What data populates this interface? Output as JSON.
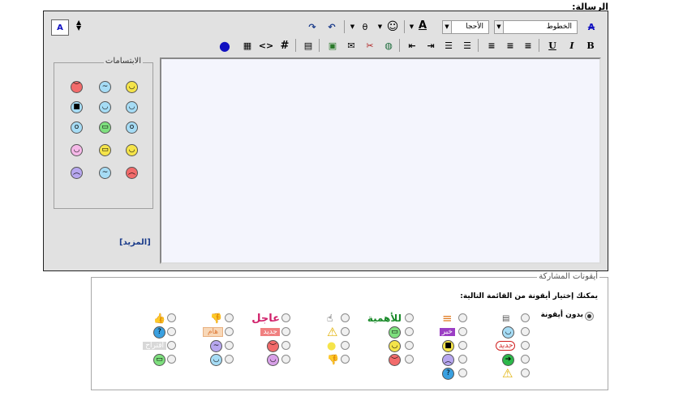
{
  "message_label": "الرسالة:",
  "toolbar": {
    "font_select": "الخطوط",
    "size_select": "الأحجا",
    "bold": "B",
    "italic": "I",
    "underline": "U",
    "font_color_letter": "A",
    "hash": "#",
    "code": "<>",
    "font_color": "#1010c0",
    "active_color": "#000000"
  },
  "smilies": {
    "legend": "الابتسامات",
    "more": "[المزيد]",
    "items": [
      {
        "name": "smile-icon",
        "color": "#f5e44a",
        "glyph": "◡"
      },
      {
        "name": "confused-icon",
        "color": "#a6dcf5",
        "glyph": "~"
      },
      {
        "name": "angry-icon",
        "color": "#f26b6b",
        "glyph": "︶"
      },
      {
        "name": "cool-icon",
        "color": "#a6dcf5",
        "glyph": "◡"
      },
      {
        "name": "grin-blue-icon",
        "color": "#a6dcf5",
        "glyph": "◡"
      },
      {
        "name": "sunglasses-icon",
        "color": "#a6dcf5",
        "glyph": "■"
      },
      {
        "name": "shock-icon",
        "color": "#a6dcf5",
        "glyph": "o"
      },
      {
        "name": "teeth-icon",
        "color": "#7ee07e",
        "glyph": "▭"
      },
      {
        "name": "scared-icon",
        "color": "#a6dcf5",
        "glyph": "o"
      },
      {
        "name": "wink-icon",
        "color": "#f5e44a",
        "glyph": "◡"
      },
      {
        "name": "laugh-icon",
        "color": "#f5e44a",
        "glyph": "▭"
      },
      {
        "name": "tongue-icon",
        "color": "#f5b8e8",
        "glyph": "◡"
      },
      {
        "name": "mad-icon",
        "color": "#f26b6b",
        "glyph": "︵"
      },
      {
        "name": "puzzled-icon",
        "color": "#a6dcf5",
        "glyph": "~"
      },
      {
        "name": "sad-icon",
        "color": "#b7a7ef",
        "glyph": "︵"
      }
    ]
  },
  "post_icons": {
    "legend": "أيقونات المشاركة",
    "hint": "يمكنك إختيار أيقونة من القائمة التالية:",
    "no_icon": "بدون أيقونة",
    "labels": {
      "important": "للأهمية",
      "urgent": "عاجل",
      "new": "جديد",
      "news": "خبر",
      "new2": "جديد",
      "question": "هام",
      "suggestion": "اقتراح"
    }
  }
}
